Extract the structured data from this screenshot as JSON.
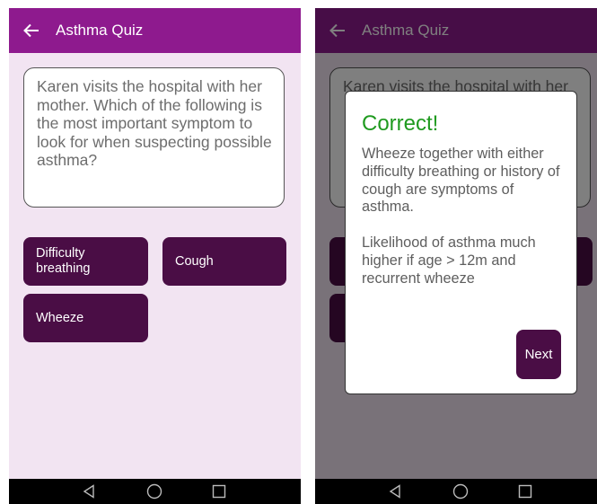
{
  "app": {
    "title": "Asthma Quiz"
  },
  "question": {
    "text": "Karen visits the hospital with her mother. Which  of the following is the most important symptom to look for when suspecting possible asthma?",
    "overlap_text": "Karen visits the hospital with her"
  },
  "answers": [
    {
      "label": "Difficulty breathing"
    },
    {
      "label": "Cough"
    },
    {
      "label": "Wheeze"
    }
  ],
  "feedback": {
    "title": "Correct!",
    "body": "Wheeze together with either difficulty breathing or history of cough are symptoms of asthma.\n\n Likelihood of asthma much higher if age > 12m and recurrent wheeze",
    "next_label": "Next"
  },
  "colors": {
    "appbar": "#8e1a8e",
    "background": "#f2e4f2",
    "button": "#4a0d45",
    "correct": "#1f9a1f"
  },
  "icons": [
    "back-arrow-icon",
    "nav-back-icon",
    "nav-home-icon",
    "nav-recent-icon"
  ]
}
